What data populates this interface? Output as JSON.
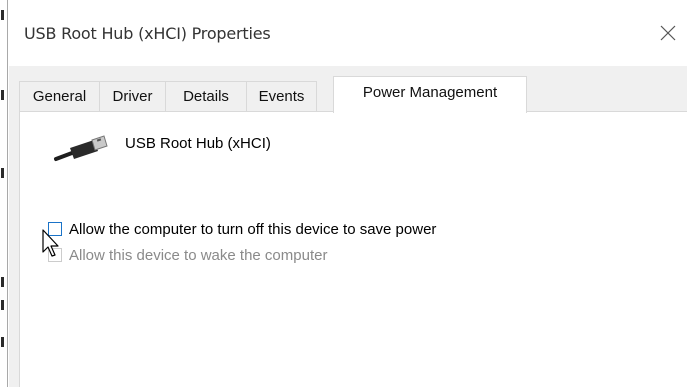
{
  "window": {
    "title": "USB Root Hub (xHCI) Properties",
    "close_icon": "close-icon"
  },
  "tabs": [
    {
      "label": "General",
      "active": false
    },
    {
      "label": "Driver",
      "active": false
    },
    {
      "label": "Details",
      "active": false
    },
    {
      "label": "Events",
      "active": false
    },
    {
      "label": "Power Management",
      "active": true
    }
  ],
  "device": {
    "icon": "usb-connector-icon",
    "name": "USB Root Hub (xHCI)"
  },
  "options": [
    {
      "label": "Allow the computer to turn off this device to save power",
      "checked": false,
      "enabled": true
    },
    {
      "label": "Allow this device to wake the computer",
      "checked": false,
      "enabled": false
    }
  ],
  "colors": {
    "checkbox_border_focus": "#1a73c8",
    "dialog_background": "#f0f0f0",
    "disabled_text": "#8a8a8a"
  }
}
